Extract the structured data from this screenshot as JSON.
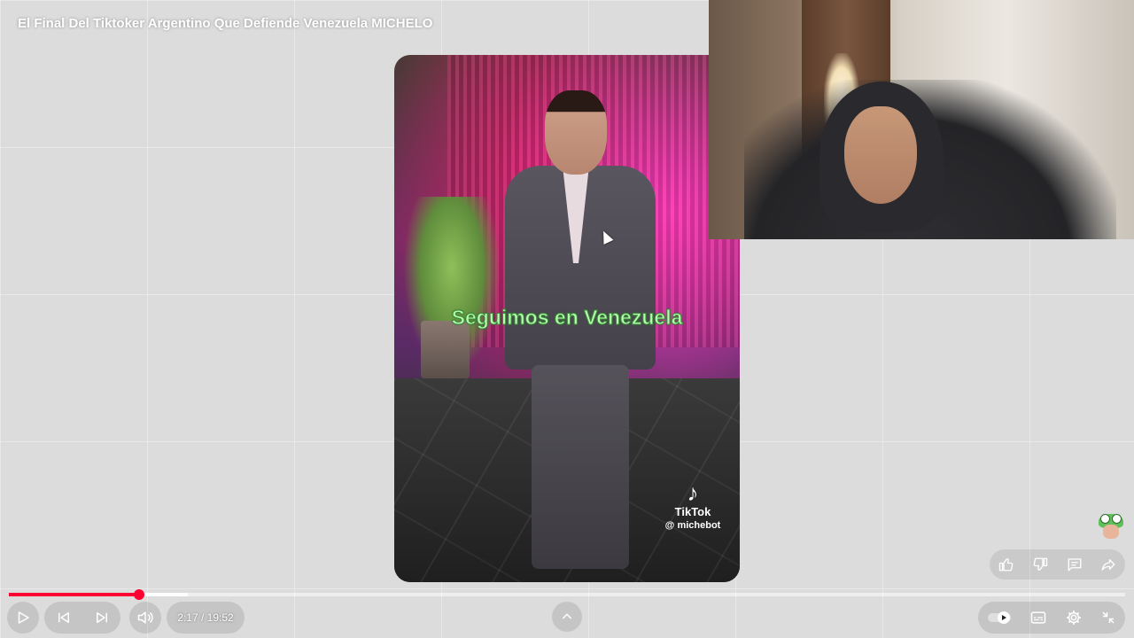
{
  "video": {
    "title": "El Final Del Tiktoker Argentino Que Defiende Venezuela MICHELO"
  },
  "overlay": {
    "subtitle": "Seguimos en Venezuela",
    "tiktok_brand": "TikTok",
    "tiktok_handle": "@ michebot"
  },
  "player": {
    "time_display": "2:17 / 19:52",
    "progress_fraction": 0.1167,
    "buffered_fraction": 0.16,
    "accent_color": "#ff0033"
  },
  "icons": {
    "play": "play-icon",
    "previous": "previous-icon",
    "next": "next-icon",
    "volume": "volume-icon",
    "expand": "chevron-up-icon",
    "autoplay": "autoplay-toggle-icon",
    "subtitles": "subtitles-icon",
    "settings": "gear-icon",
    "exit_fullscreen": "exit-fullscreen-icon",
    "like": "thumbs-up-icon",
    "dislike": "thumbs-down-icon",
    "comments": "comment-icon",
    "share": "share-icon"
  }
}
